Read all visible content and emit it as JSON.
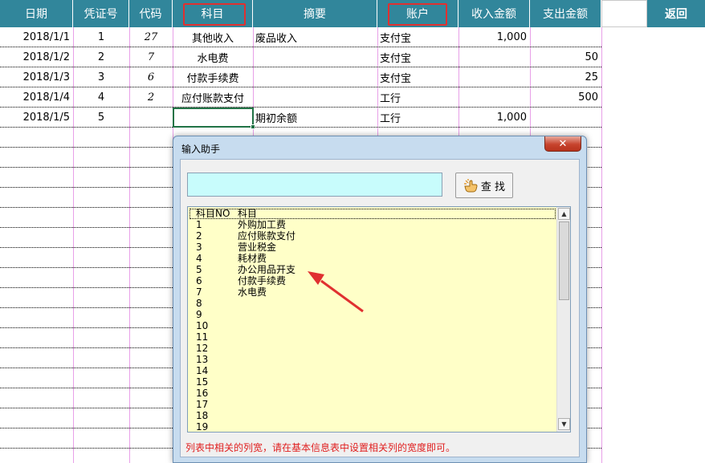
{
  "header": {
    "columns": [
      "日期",
      "凭证号",
      "代码",
      "科目",
      "摘要",
      "账户",
      "收入金额",
      "支出金额"
    ],
    "return_label": "返回"
  },
  "rows": [
    {
      "date": "2018/1/1",
      "voucher": "1",
      "code": "27",
      "subject": "其他收入",
      "summary": "废品收入",
      "account": "支付宝",
      "income": "1,000",
      "expense": ""
    },
    {
      "date": "2018/1/2",
      "voucher": "2",
      "code": "7",
      "subject": "水电费",
      "summary": "",
      "account": "支付宝",
      "income": "",
      "expense": "50"
    },
    {
      "date": "2018/1/3",
      "voucher": "3",
      "code": "6",
      "subject": "付款手续费",
      "summary": "",
      "account": "支付宝",
      "income": "",
      "expense": "25"
    },
    {
      "date": "2018/1/4",
      "voucher": "4",
      "code": "2",
      "subject": "应付账款支付",
      "summary": "",
      "account": "工行",
      "income": "",
      "expense": "500"
    },
    {
      "date": "2018/1/5",
      "voucher": "5",
      "code": "",
      "subject": "",
      "summary": "期初余额",
      "account": "工行",
      "income": "1,000",
      "expense": ""
    }
  ],
  "dialog": {
    "title": "输入助手",
    "close_label": "✕",
    "search_value": "",
    "find_label": "查 找",
    "list_header": {
      "no": "科目NO",
      "name": "科目"
    },
    "list_items": [
      {
        "no": "1",
        "name": "外购加工费"
      },
      {
        "no": "2",
        "name": "应付账款支付"
      },
      {
        "no": "3",
        "name": "营业税金"
      },
      {
        "no": "4",
        "name": "耗材费"
      },
      {
        "no": "5",
        "name": "办公用品开支"
      },
      {
        "no": "6",
        "name": "付款手续费"
      },
      {
        "no": "7",
        "name": "水电费"
      },
      {
        "no": "8",
        "name": ""
      },
      {
        "no": "9",
        "name": ""
      },
      {
        "no": "10",
        "name": ""
      },
      {
        "no": "11",
        "name": ""
      },
      {
        "no": "12",
        "name": ""
      },
      {
        "no": "13",
        "name": ""
      },
      {
        "no": "14",
        "name": ""
      },
      {
        "no": "15",
        "name": ""
      },
      {
        "no": "16",
        "name": ""
      },
      {
        "no": "17",
        "name": ""
      },
      {
        "no": "18",
        "name": ""
      },
      {
        "no": "19",
        "name": ""
      }
    ],
    "hint": "列表中相关的列宽，请在基本信息表中设置相关列的宽度即可。"
  },
  "colors": {
    "header_bg": "#31869b",
    "highlight_box": "#e03030",
    "arrow": "#e03030",
    "search_bg": "#c8fcfc",
    "list_bg": "#ffffc8",
    "hint_text": "#e02020"
  },
  "icons": {
    "find": "pointing-hand-icon",
    "close": "close-icon"
  }
}
